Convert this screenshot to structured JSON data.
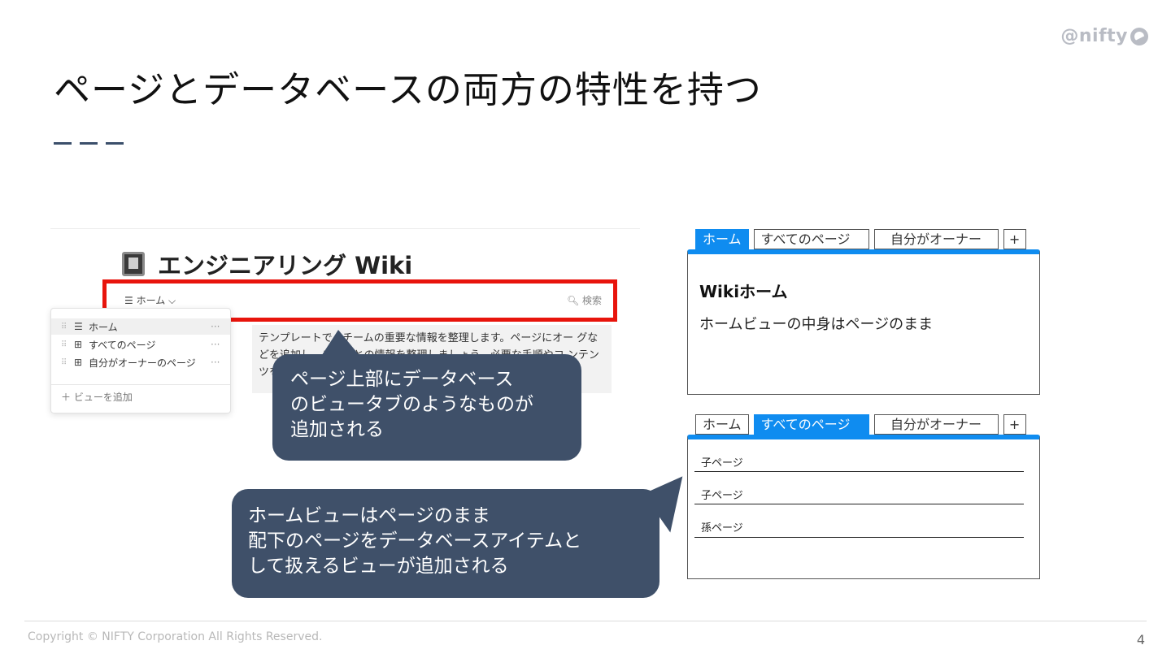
{
  "brand": {
    "logo_text": "@nifty"
  },
  "slide": {
    "title": "ページとデータベースの両方の特性を持つ",
    "page_number": "4",
    "copyright": "Copyright © NIFTY Corporation All Rights Reserved."
  },
  "notion": {
    "title": "エンジニアリング Wiki",
    "view_bar": {
      "home": "☰ ホーム ⌵",
      "search": "🔍︎ 検索"
    },
    "body_text": "テンプレートで、チームの重要な情報を整理します。ページにオー グなどを追加し、チームとの情報を整理しましょう。必要な手順やコ ンテンツを含めてご利用ください。",
    "menu": {
      "items": [
        {
          "icon": "☰",
          "label": "ホーム",
          "active": true
        },
        {
          "icon": "⊞",
          "label": "すべてのページ",
          "active": false
        },
        {
          "icon": "⊞",
          "label": "自分がオーナーのページ",
          "active": false
        }
      ],
      "add_view": "＋ ビューを追加"
    }
  },
  "callouts": {
    "top": [
      "ページ上部にデータベース",
      "のビュータブのようなものが",
      "追加される"
    ],
    "bottom": [
      "ホームビューはページのまま",
      "配下のページをデータベースアイテムと",
      "して扱えるビューが追加される"
    ]
  },
  "mockup_home": {
    "tabs": [
      "ホーム",
      "すべてのページ",
      "自分がオーナー",
      "+"
    ],
    "active_tab": "ホーム",
    "heading": "Wikiホーム",
    "body": "ホームビューの中身はページのまま"
  },
  "mockup_all": {
    "tabs": [
      "ホーム",
      "すべてのページ",
      "自分がオーナー",
      "+"
    ],
    "active_tab": "すべてのページ",
    "rows": [
      "子ページ",
      "子ページ",
      "孫ページ"
    ]
  },
  "colors": {
    "accent_blue": "#0f8cf0",
    "callout_bg": "#3f5069",
    "highlight_red": "#e8140c"
  }
}
